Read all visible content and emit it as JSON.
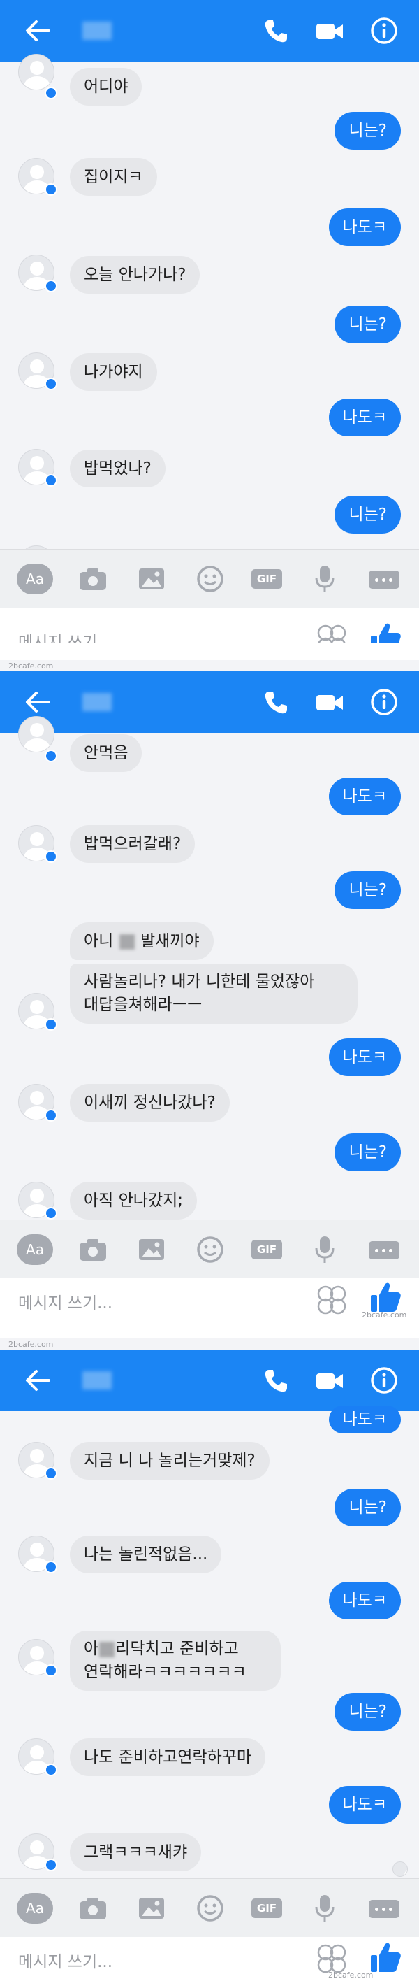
{
  "header": {
    "title": ""
  },
  "composer": {
    "placeholder": "메시지 쓰기...",
    "aa_label": "Aa",
    "gif_label": "GIF"
  },
  "colors": {
    "accent": "#1b85f4",
    "outgoing_bubble": "#1a7ff5",
    "incoming_bubble": "#e6e7ea"
  },
  "watermark": "2bcafe.com",
  "screens": [
    {
      "messages": [
        {
          "side": "in",
          "text": "어디야"
        },
        {
          "side": "out",
          "text": "니는?"
        },
        {
          "side": "in",
          "text": "집이지ㅋ"
        },
        {
          "side": "out",
          "text": "나도ㅋ"
        },
        {
          "side": "in",
          "text": "오늘 안나가나?"
        },
        {
          "side": "out",
          "text": "니는?"
        },
        {
          "side": "in",
          "text": "나가야지"
        },
        {
          "side": "out",
          "text": "나도ㅋ"
        },
        {
          "side": "in",
          "text": "밥먹었나?"
        },
        {
          "side": "out",
          "text": "니는?"
        }
      ]
    },
    {
      "messages": [
        {
          "side": "in",
          "text": "안먹음"
        },
        {
          "side": "out",
          "text": "나도ㅋ"
        },
        {
          "side": "in",
          "text": "밥먹으러갈래?"
        },
        {
          "side": "out",
          "text": "니는?"
        },
        {
          "side": "in",
          "text_before": "아니",
          "text_after": "발새끼야"
        },
        {
          "side": "in",
          "line1": "사람놀리나? 내가 니한테 물었잖아",
          "line2": "대답을쳐해라ㅡㅡ"
        },
        {
          "side": "out",
          "text": "나도ㅋ"
        },
        {
          "side": "in",
          "text": "이새끼 정신나갔나?"
        },
        {
          "side": "out",
          "text": "니는?"
        },
        {
          "side": "in",
          "text": "아직 안나갔지;"
        }
      ]
    },
    {
      "messages": [
        {
          "side": "out",
          "text": "나도ㅋ"
        },
        {
          "side": "in",
          "text": "지금 니 나 놀리는거맞제?"
        },
        {
          "side": "out",
          "text": "니는?"
        },
        {
          "side": "in",
          "text": "나는 놀린적없음..."
        },
        {
          "side": "out",
          "text": "나도ㅋ"
        },
        {
          "side": "in",
          "line1_before": "아",
          "line1_after": "리닥치고 준비하고",
          "line2": "연락해라ㅋㅋㅋㅋㅋㅋㅋ"
        },
        {
          "side": "out",
          "text": "니는?"
        },
        {
          "side": "in",
          "text": "나도 준비하고연락하꾸마"
        },
        {
          "side": "out",
          "text": "나도ㅋ"
        },
        {
          "side": "in",
          "text": "그랙ㅋㅋㅋ새캬"
        }
      ]
    }
  ]
}
